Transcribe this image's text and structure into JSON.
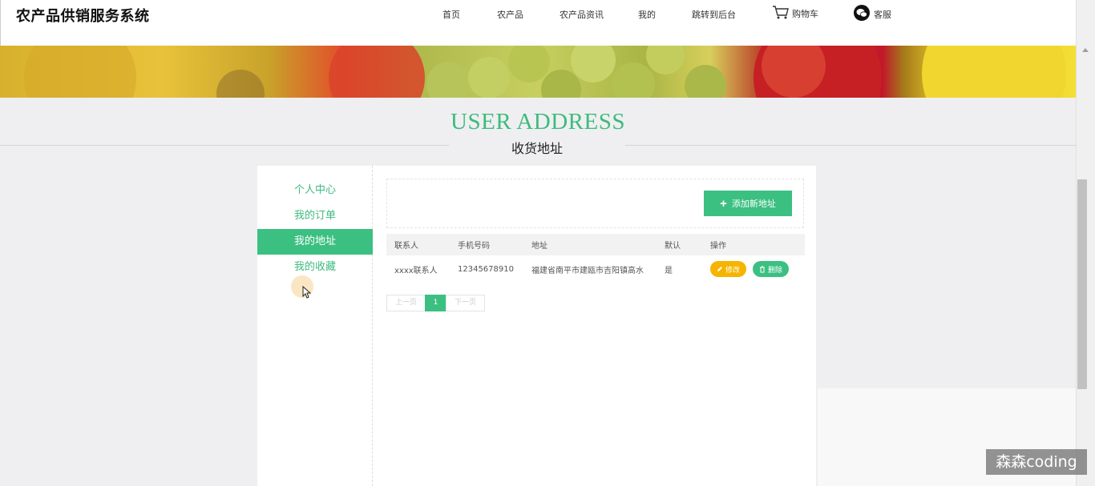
{
  "brand": "农产品供销服务系统",
  "nav": {
    "home": "首页",
    "products": "农产品",
    "news": "农产品资讯",
    "mine": "我的",
    "admin": "跳转到后台",
    "cart": "购物车",
    "service": "客服"
  },
  "section": {
    "title": "USER ADDRESS",
    "subtitle": "收货地址"
  },
  "sidebar": {
    "items": [
      {
        "label": "个人中心"
      },
      {
        "label": "我的订单"
      },
      {
        "label": "我的地址",
        "active": true
      },
      {
        "label": "我的收藏"
      }
    ]
  },
  "toolbar": {
    "add_label": "添加新地址"
  },
  "table": {
    "headers": [
      "联系人",
      "手机号码",
      "地址",
      "默认",
      "操作"
    ],
    "rows": [
      {
        "contact": "xxxx联系人",
        "phone": "12345678910",
        "address": "福建省南平市建瓯市吉阳镇高水",
        "is_default": "是",
        "edit_label": "修改",
        "delete_label": "删除"
      }
    ]
  },
  "pager": {
    "prev": "上一页",
    "current": "1",
    "next": "下一页"
  },
  "watermark": "森森coding",
  "colors": {
    "accent": "#3cc082",
    "title_green": "#3dbb7e",
    "edit_yellow": "#f5b400"
  }
}
